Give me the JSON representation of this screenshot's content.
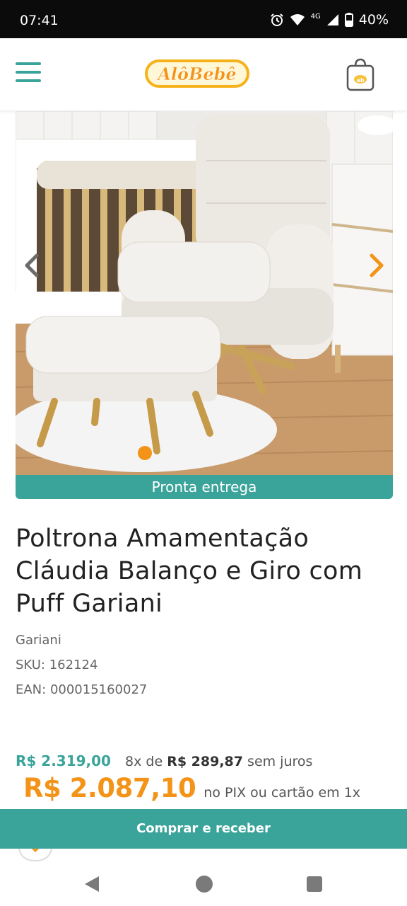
{
  "status_bar": {
    "time": "07:41",
    "network": "4G",
    "battery": "40%",
    "icons": [
      "alarm-icon",
      "wifi-icon",
      "signal-icon",
      "battery-icon"
    ]
  },
  "header": {
    "logo_text": "AlôBebê",
    "menu_icon": "hamburger-menu-icon",
    "cart_icon": "shopping-bag-icon"
  },
  "carousel": {
    "prev_icon": "chevron-left-icon",
    "next_icon": "chevron-right-icon",
    "banner": "Pronta entrega"
  },
  "product": {
    "title": "Poltrona Amamentação Cláudia Balanço e Giro com Puff Gariani",
    "brand": "Gariani",
    "sku": "SKU: 162124",
    "ean": "EAN: 000015160027"
  },
  "pricing": {
    "old_price": "R$ 2.319,00",
    "installments_prefix": "8x de",
    "installment_value": "R$ 289,87",
    "installments_suffix": "sem juros",
    "pix_price": "R$ 2.087,10",
    "pix_note": "no PIX ou cartão em 1x"
  },
  "actions": {
    "buy_label": "Comprar e receber"
  },
  "colors": {
    "brand_teal": "#3aa39a",
    "brand_orange": "#f39419"
  }
}
